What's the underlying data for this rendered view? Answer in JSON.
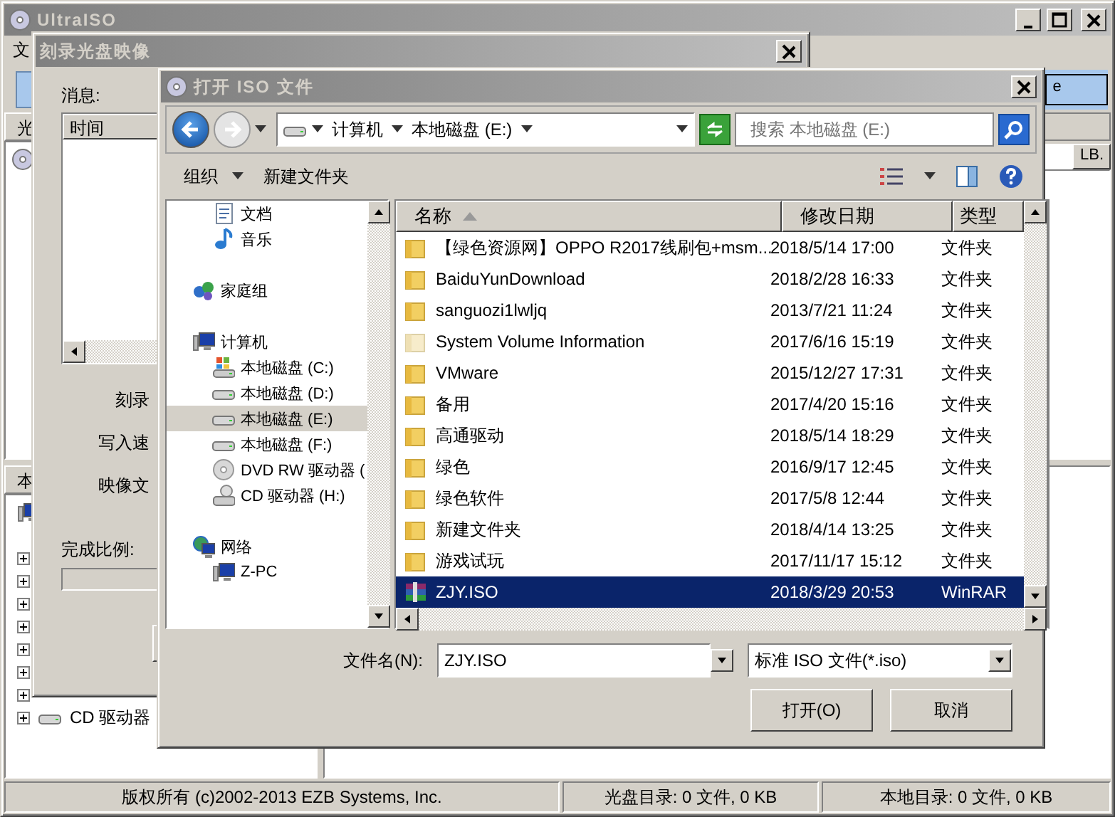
{
  "main_window": {
    "title": "UltraISO",
    "menu": [
      "文"
    ],
    "toolbar_field": "e",
    "upper_pane_header": "光",
    "list_columns": [
      "LB."
    ],
    "lower_tab": "本",
    "tree_item": "CD 驱动器"
  },
  "burn_dialog": {
    "title": "刻录光盘映像",
    "messages_label": "消息:",
    "messages_columns": [
      "时间"
    ],
    "fields": [
      "刻录",
      "写入速",
      "映像文"
    ],
    "progress_label": "完成比例:",
    "progress": {
      "level": 0
    }
  },
  "open_dialog": {
    "title": "打开 ISO 文件",
    "breadcrumb": [
      "计算机",
      "本地磁盘 (E:)"
    ],
    "search": {
      "placeholder": "搜索 本地磁盘 (E:)"
    },
    "toolbar": [
      "组织",
      "新建文件夹"
    ],
    "nav_tree": [
      {
        "children": [
          {
            "label": "文档",
            "kind": "document",
            "selected": false
          },
          {
            "label": "音乐",
            "kind": "music",
            "selected": false
          }
        ]
      },
      {
        "label": "家庭组",
        "kind": "homegroup",
        "selected": false
      },
      {
        "label": "计算机",
        "kind": "computer",
        "selected": false,
        "children": [
          {
            "label": "本地磁盘 (C:)",
            "kind": "system-drive",
            "selected": false
          },
          {
            "label": "本地磁盘 (D:)",
            "kind": "drive",
            "selected": false
          },
          {
            "label": "本地磁盘 (E:)",
            "kind": "drive",
            "selected": true
          },
          {
            "label": "本地磁盘 (F:)",
            "kind": "drive",
            "selected": false
          },
          {
            "label": "DVD RW 驱动器 (",
            "kind": "dvd",
            "selected": false
          },
          {
            "label": "CD 驱动器 (H:)",
            "kind": "cd",
            "selected": false
          }
        ]
      },
      {
        "label": "网络",
        "kind": "network",
        "selected": false,
        "children": [
          {
            "label": "Z-PC",
            "kind": "pc",
            "selected": false
          }
        ]
      }
    ],
    "columns": [
      "名称",
      "修改日期",
      "类型"
    ],
    "files": [
      {
        "name": "【绿色资源网】OPPO R2017线刷包+msm...",
        "date": "2018/5/14 17:00",
        "type": "文件夹",
        "kind": "folder",
        "selected": false
      },
      {
        "name": "BaiduYunDownload",
        "date": "2018/2/28 16:33",
        "type": "文件夹",
        "kind": "folder",
        "selected": false
      },
      {
        "name": "sanguozi1lwljq",
        "date": "2013/7/21 11:24",
        "type": "文件夹",
        "kind": "folder",
        "selected": false
      },
      {
        "name": "System Volume Information",
        "date": "2017/6/16 15:19",
        "type": "文件夹",
        "kind": "hidden-folder",
        "selected": false
      },
      {
        "name": "VMware",
        "date": "2015/12/27 17:31",
        "type": "文件夹",
        "kind": "folder",
        "selected": false
      },
      {
        "name": "备用",
        "date": "2017/4/20 15:16",
        "type": "文件夹",
        "kind": "folder",
        "selected": false
      },
      {
        "name": "高通驱动",
        "date": "2018/5/14 18:29",
        "type": "文件夹",
        "kind": "folder",
        "selected": false
      },
      {
        "name": "绿色",
        "date": "2016/9/17 12:45",
        "type": "文件夹",
        "kind": "folder",
        "selected": false
      },
      {
        "name": "绿色软件",
        "date": "2017/5/8 12:44",
        "type": "文件夹",
        "kind": "folder",
        "selected": false
      },
      {
        "name": "新建文件夹",
        "date": "2018/4/14 13:25",
        "type": "文件夹",
        "kind": "folder",
        "selected": false
      },
      {
        "name": "游戏试玩",
        "date": "2017/11/17 15:12",
        "type": "文件夹",
        "kind": "folder",
        "selected": false
      },
      {
        "name": "ZJY.ISO",
        "date": "2018/3/29 20:53",
        "type": "WinRAR",
        "kind": "archive",
        "selected": true
      }
    ],
    "file_name_label": "文件名(N):",
    "file_name": "ZJY.ISO",
    "file_type": "标准 ISO 文件(*.iso)",
    "buttons": [
      "打开(O)",
      "取消"
    ]
  },
  "status_bar": [
    "版权所有 (c)2002-2013 EZB Systems, Inc.",
    "光盘目录: 0 文件, 0 KB",
    "本地目录: 0 文件, 0 KB"
  ]
}
